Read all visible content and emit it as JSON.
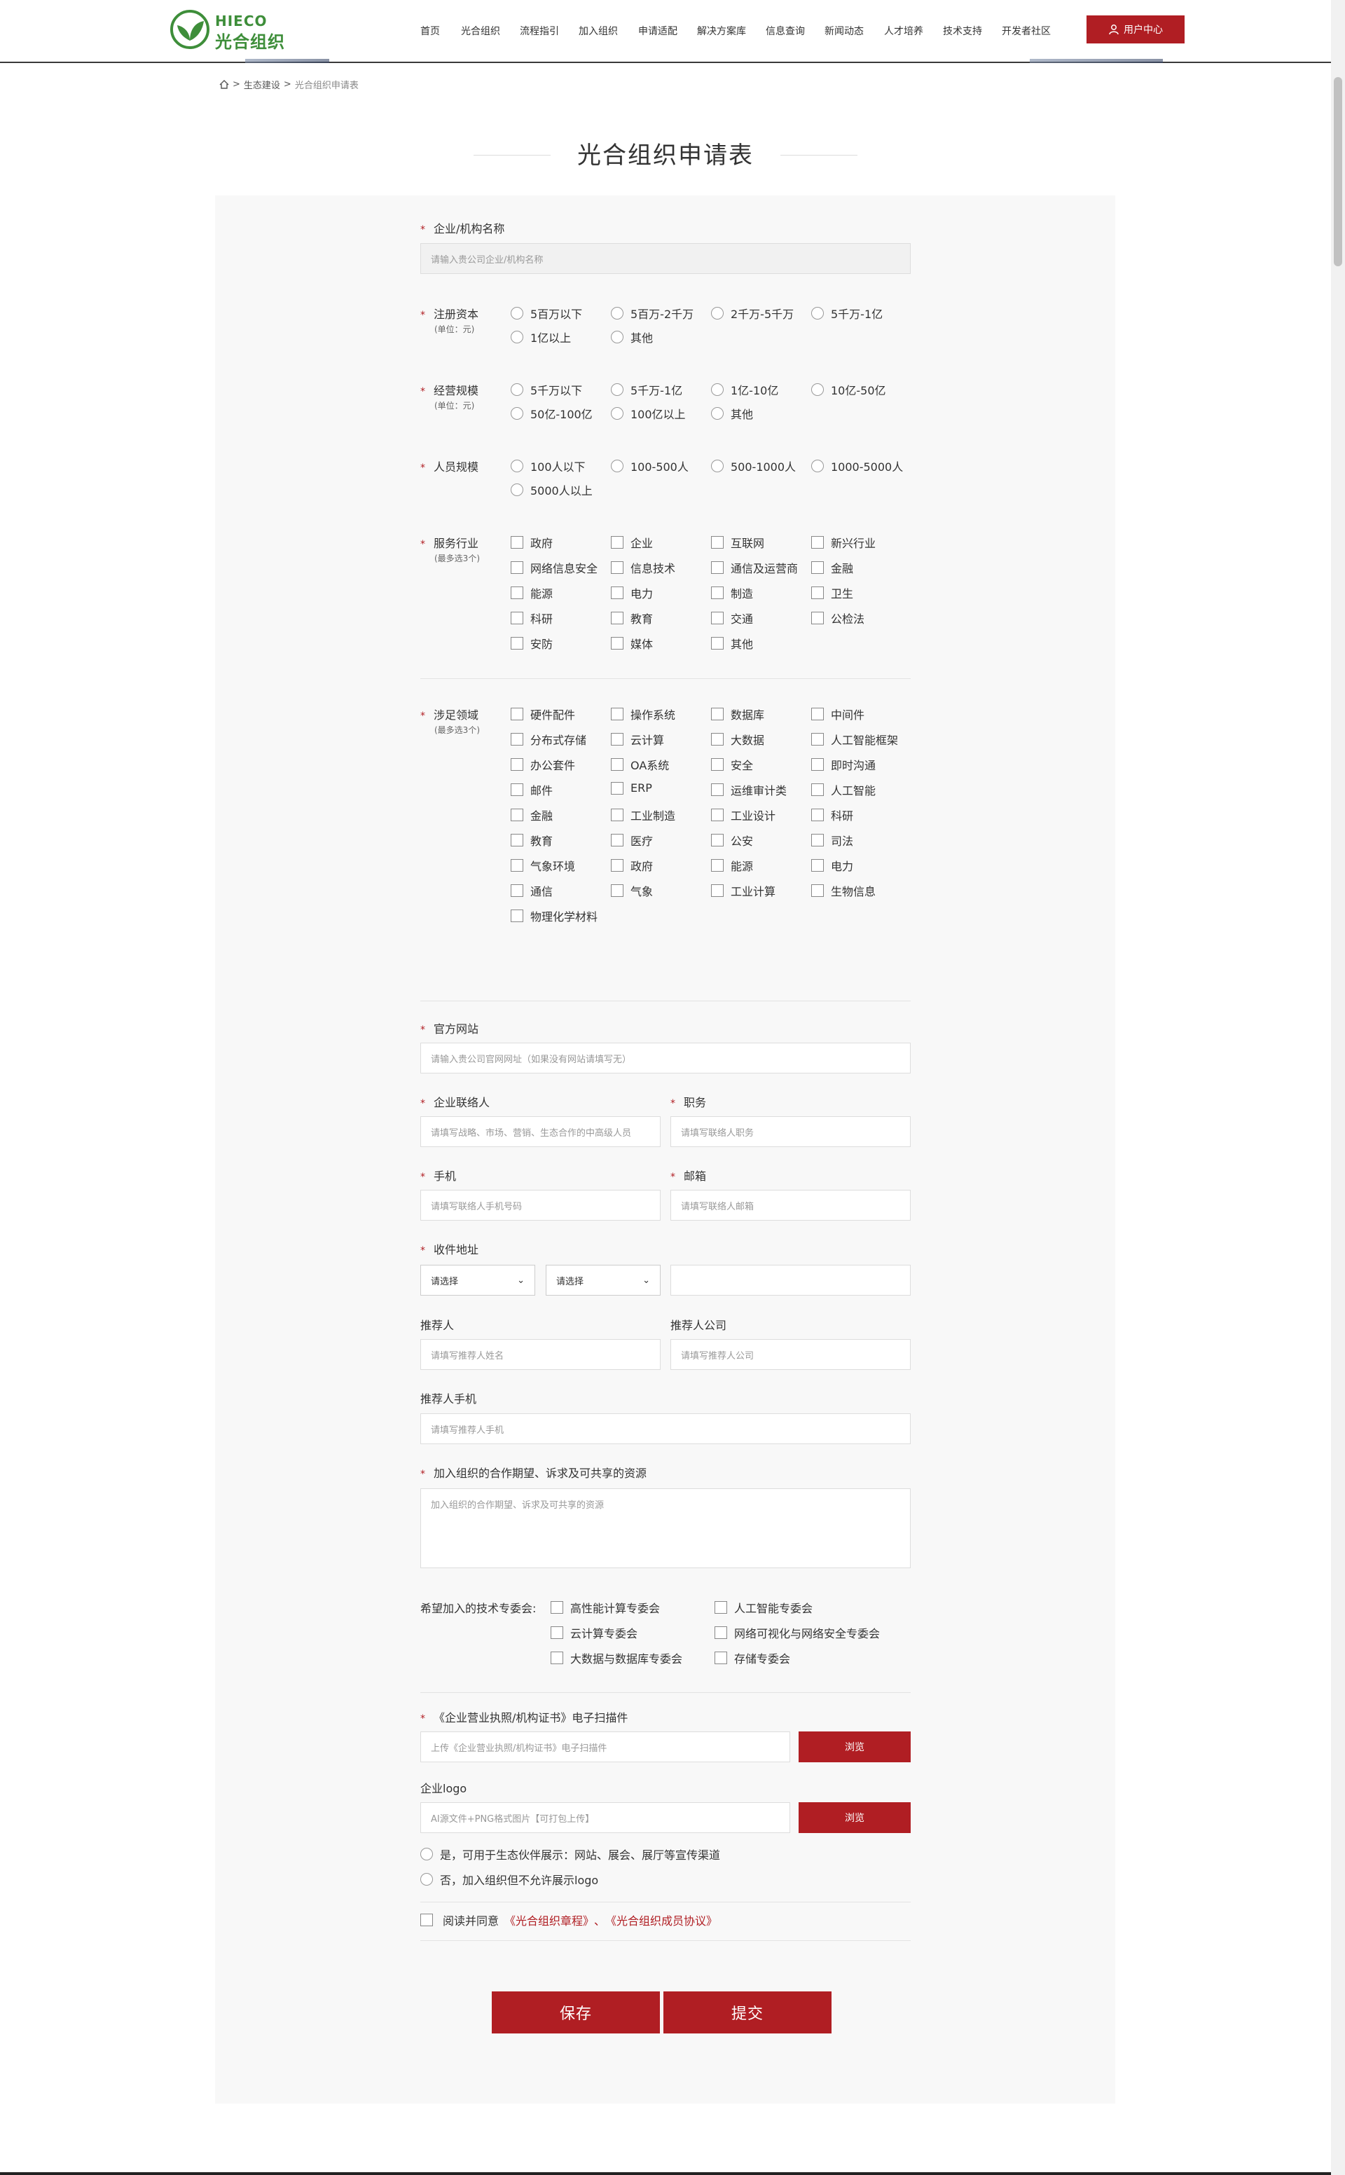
{
  "header": {
    "logo_en": "HIECO",
    "logo_cn": "光合组织",
    "nav": [
      "首页",
      "光合组织",
      "流程指引",
      "加入组织",
      "申请适配",
      "解决方案库",
      "信息查询",
      "新闻动态",
      "人才培养",
      "技术支持",
      "开发者社区"
    ],
    "user_center": "用户中心"
  },
  "breadcrumb": {
    "home_icon": "home-icon",
    "sep1": ">",
    "item1": "生态建设",
    "sep2": ">",
    "current": "光合组织申请表"
  },
  "page_title": "光合组织申请表",
  "form": {
    "star": "*",
    "company_name": {
      "label": "企业/机构名称",
      "placeholder": "请输入贵公司企业/机构名称"
    },
    "capital": {
      "label": "注册资本",
      "sub": "(单位：元)",
      "options": [
        "5百万以下",
        "5百万-2千万",
        "2千万-5千万",
        "5千万-1亿",
        "1亿以上",
        "其他"
      ]
    },
    "revenue": {
      "label": "经营规模",
      "sub": "(单位：元)",
      "options": [
        "5千万以下",
        "5千万-1亿",
        "1亿-10亿",
        "10亿-50亿",
        "50亿-100亿",
        "100亿以上",
        "其他"
      ]
    },
    "staff": {
      "label": "人员规模",
      "options": [
        "100人以下",
        "100-500人",
        "500-1000人",
        "1000-5000人",
        "5000人以上"
      ]
    },
    "industry": {
      "label": "服务行业",
      "sub": "(最多选3个)",
      "options": [
        "政府",
        "企业",
        "互联网",
        "新兴行业",
        "网络信息安全",
        "信息技术",
        "通信及运营商",
        "金融",
        "能源",
        "电力",
        "制造",
        "卫生",
        "科研",
        "教育",
        "交通",
        "公检法",
        "安防",
        "媒体",
        "其他"
      ]
    },
    "domain": {
      "label": "涉足领域",
      "sub": "(最多选3个)",
      "options": [
        "硬件配件",
        "操作系统",
        "数据库",
        "中间件",
        "分布式存储",
        "云计算",
        "大数据",
        "人工智能框架",
        "办公套件",
        "OA系统",
        "安全",
        "即时沟通",
        "邮件",
        "ERP",
        "运维审计类",
        "人工智能",
        "金融",
        "工业制造",
        "工业设计",
        "科研",
        "教育",
        "医疗",
        "公安",
        "司法",
        "气象环境",
        "政府",
        "能源",
        "电力",
        "通信",
        "气象",
        "工业计算",
        "生物信息",
        "物理化学材料"
      ]
    },
    "website": {
      "label": "官方网站",
      "placeholder": "请输入贵公司官网网址（如果没有网站请填写无）"
    },
    "contact": {
      "label": "企业联络人",
      "placeholder": "请填写战略、市场、营销、生态合作的中高级人员"
    },
    "position": {
      "label": "职务",
      "placeholder": "请填写联络人职务"
    },
    "phone": {
      "label": "手机",
      "placeholder": "请填写联络人手机号码"
    },
    "email": {
      "label": "邮箱",
      "placeholder": "请填写联络人邮箱"
    },
    "address": {
      "label": "收件地址",
      "select1": "请选择",
      "select2": "请选择",
      "detail": ""
    },
    "referrer": {
      "label": "推荐人",
      "placeholder": "请填写推荐人姓名"
    },
    "referrer_company": {
      "label": "推荐人公司",
      "placeholder": "请填写推荐人公司"
    },
    "referrer_phone": {
      "label": "推荐人手机",
      "placeholder": "请填写推荐人手机"
    },
    "expectation": {
      "label": "加入组织的合作期望、诉求及可共享的资源",
      "placeholder": "加入组织的合作期望、诉求及可共享的资源"
    },
    "committee": {
      "label": "希望加入的技术专委会:",
      "options": [
        "高性能计算专委会",
        "人工智能专委会",
        "云计算专委会",
        "网络可视化与网络安全专委会",
        "大数据与数据库专委会",
        "存储专委会"
      ]
    },
    "license": {
      "label": "《企业营业执照/机构证书》电子扫描件",
      "placeholder": "上传《企业营业执照/机构证书》电子扫描件",
      "browse": "浏览"
    },
    "logo": {
      "label": "企业logo",
      "placeholder": "AI源文件+PNG格式图片【可打包上传】",
      "browse": "浏览"
    },
    "logo_usage": [
      "是，可用于生态伙伴展示：网站、展会、展厅等宣传渠道",
      "否，加入组织但不允许展示logo"
    ],
    "agree": {
      "prefix": "阅读并同意",
      "link1": "《光合组织章程》",
      "sep": "、",
      "link2": "《光合组织成员协议》"
    },
    "save": "保存",
    "submit": "提交"
  },
  "colors": {
    "accent": "#b01e23",
    "brand_green": "#3e8e3a",
    "panel_bg": "#f8f8f8"
  }
}
